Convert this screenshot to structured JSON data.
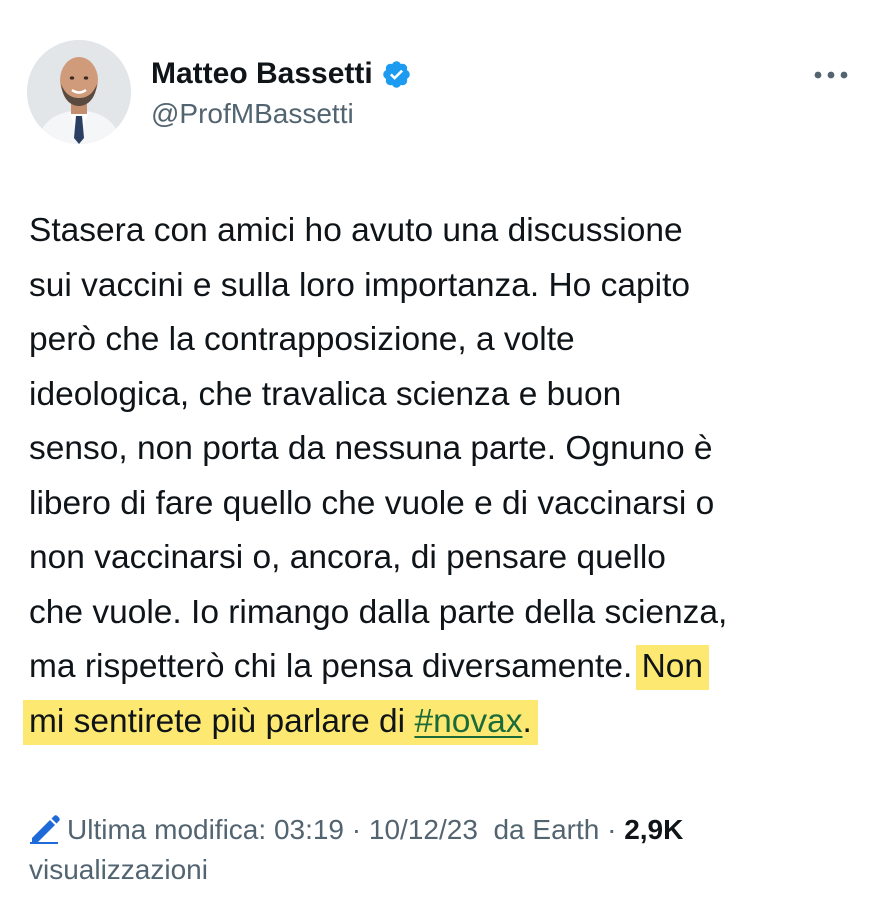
{
  "author": {
    "display_name": "Matteo Bassetti",
    "handle": "@ProfMBassetti",
    "verified": true
  },
  "icons": {
    "verified": "verified-badge-icon",
    "more": "more-horizontal-icon",
    "edit": "pencil-edit-icon"
  },
  "tweet": {
    "lines_plain": [
      "Stasera con amici ho avuto una discussione",
      "sui vaccini e sulla loro importanza. Ho capito",
      "però che la contrapposizione, a volte",
      "ideologica, che travalica scienza e buon",
      "senso, non porta da nessuna parte. Ognuno è",
      "libero di fare quello che vuole e di vaccinarsi o",
      "non vaccinarsi o, ancora, di pensare quello",
      "che vuole. Io rimango dalla parte della scienza,"
    ],
    "line9_plain": "ma rispetterò chi la pensa diversamente. ",
    "line9_highlight": "Non",
    "line10_highlight": "mi sentirete più parlare di ",
    "hashtag": "#novax",
    "trailing": "."
  },
  "meta": {
    "edited_label": "Ultima modifica: 03:19",
    "separator": " · ",
    "date": "10/12/23",
    "source": "  da Earth",
    "views_count": "2,9K",
    "views_label": "visualizzazioni"
  },
  "colors": {
    "highlight": "#fde971",
    "verified_blue": "#1d9bf0",
    "secondary_text": "#536471",
    "hashtag_link": "#1b6a3a",
    "edit_icon": "#1d6ad8"
  }
}
